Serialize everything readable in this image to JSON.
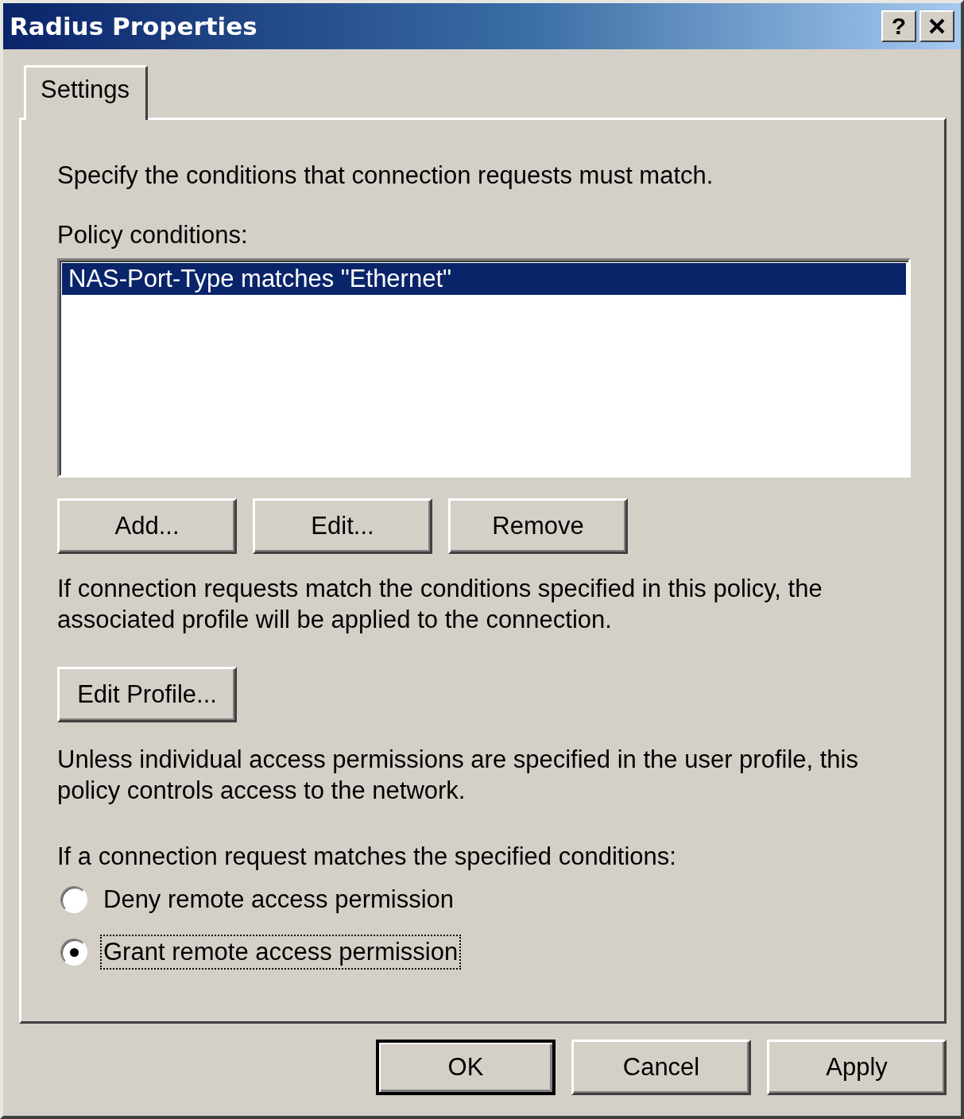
{
  "window": {
    "title": "Radius Properties",
    "help": "?"
  },
  "tabs": [
    {
      "label": "Settings",
      "selected": true
    }
  ],
  "intro": "Specify the conditions that connection requests must match.",
  "conditions_label": "Policy conditions:",
  "conditions": [
    {
      "text": "NAS-Port-Type matches \"Ethernet\"",
      "selected": true
    }
  ],
  "condition_buttons": [
    "Add...",
    "Edit...",
    "Remove"
  ],
  "profile_note": "If connection requests match the conditions specified in this policy, the associated profile will be applied to the connection.",
  "profile_button": "Edit Profile...",
  "access_note": "Unless individual access permissions are specified in the user profile, this policy controls access to the network.",
  "radio_prompt": "If a connection request matches the specified conditions:",
  "radios": [
    {
      "label": "Deny remote access permission",
      "selected": false,
      "focused": false
    },
    {
      "label": "Grant remote access permission",
      "selected": true,
      "focused": true
    }
  ],
  "footer_buttons": [
    {
      "label": "OK",
      "default": true
    },
    {
      "label": "Cancel",
      "default": false
    },
    {
      "label": "Apply",
      "default": false
    }
  ]
}
